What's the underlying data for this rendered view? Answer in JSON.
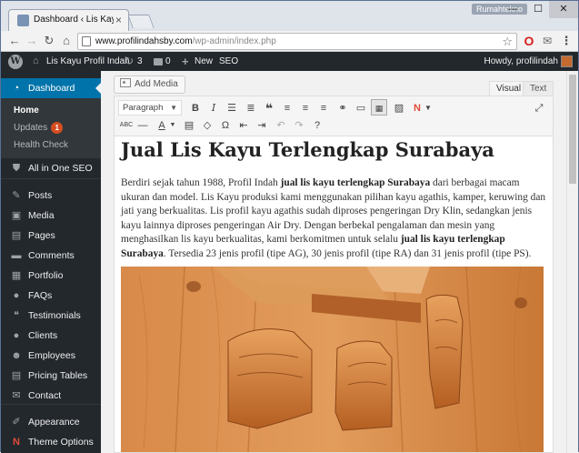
{
  "browser": {
    "tab_title": "Dashboard ‹ Lis Kayu Pro",
    "tab_close": "×",
    "profile_label": "Rumahtekno",
    "url_host": "www.profilindahsby.com",
    "url_path": "/wp-admin/index.php",
    "icons": [
      "back-icon",
      "forward-icon",
      "reload-icon",
      "home-icon",
      "star-icon",
      "opera-icon",
      "mail-icon",
      "menu-icon"
    ]
  },
  "adminbar": {
    "site_name": "Lis Kayu Profil Indah",
    "updates_count": "3",
    "comments_count": "0",
    "new_label": "New",
    "seo_label": "SEO",
    "howdy": "Howdy, profilindah"
  },
  "sidebar": {
    "dashboard": "Dashboard",
    "submenu": {
      "home": "Home",
      "updates": "Updates",
      "updates_badge": "1",
      "health": "Health Check"
    },
    "items": [
      {
        "label": "All in One SEO",
        "icon": "shield-icon",
        "glyph": "⛊"
      },
      {
        "label": "Posts",
        "icon": "pin-icon",
        "glyph": "✎"
      },
      {
        "label": "Media",
        "icon": "media-icon",
        "glyph": "▣"
      },
      {
        "label": "Pages",
        "icon": "pages-icon",
        "glyph": "▤"
      },
      {
        "label": "Comments",
        "icon": "comments-icon",
        "glyph": "▬"
      },
      {
        "label": "Portfolio",
        "icon": "portfolio-icon",
        "glyph": "▦"
      },
      {
        "label": "FAQs",
        "icon": "faq-icon",
        "glyph": "●"
      },
      {
        "label": "Testimonials",
        "icon": "quote-icon",
        "glyph": "❝"
      },
      {
        "label": "Clients",
        "icon": "clients-icon",
        "glyph": "●"
      },
      {
        "label": "Employees",
        "icon": "employees-icon",
        "glyph": "☻"
      },
      {
        "label": "Pricing Tables",
        "icon": "table-icon",
        "glyph": "▤"
      },
      {
        "label": "Contact",
        "icon": "mail-icon",
        "glyph": "✉"
      },
      {
        "label": "Appearance",
        "icon": "appearance-icon",
        "glyph": "✐"
      },
      {
        "label": "Theme Options",
        "icon": "theme-options-icon",
        "glyph": "N"
      }
    ]
  },
  "editor": {
    "add_media": "Add Media",
    "tab_visual": "Visual",
    "tab_text": "Text",
    "format": "Paragraph",
    "title": "Jual Lis Kayu Terlengkap Surabaya",
    "p1_a": "Berdiri sejak tahun 1988, Profil Indah ",
    "p1_b": "jual lis kayu terlengkap Surabaya",
    "p1_c": " dari berbagai macam ukuran dan model. Lis Kayu produksi kami menggunakan pilihan kayu agathis, kamper, keruwing dan jati yang berkualitas. Lis profil kayu agathis sudah diproses pengeringan Dry Klin, sedangkan jenis kayu lainnya diproses pengeringan Air Dry. Dengan berbekal pengalaman dan mesin yang menghasilkan lis kayu berkualitas, kami berkomitmen untuk selalu ",
    "p1_d": "jual lis kayu terlengkap Surabaya",
    "p1_e": ". Tersedia 23 jenis profil (tipe AG), 30 jenis profil (tipe RA) dan 31 jenis profil (tipe PS)."
  },
  "colors": {
    "admin_dark": "#23282d",
    "admin_blue": "#0073aa",
    "badge_orange": "#d54e21",
    "wood": "#c8743a"
  }
}
